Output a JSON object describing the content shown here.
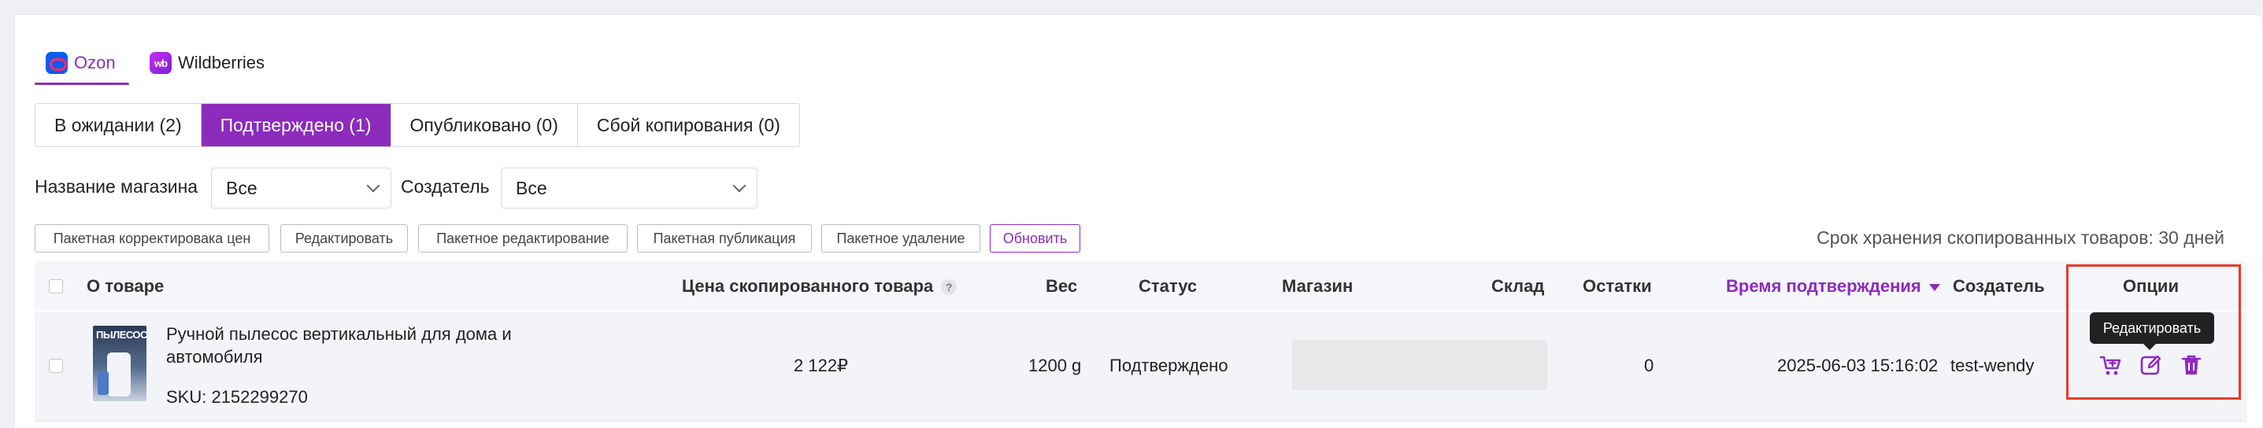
{
  "marketplace_tabs": [
    {
      "label": "Ozon",
      "active": true
    },
    {
      "label": "Wildberries",
      "active": false
    }
  ],
  "status_tabs": [
    {
      "label": "В ожидании (2)",
      "active": false
    },
    {
      "label": "Подтверждено (1)",
      "active": true
    },
    {
      "label": "Опубликовано (0)",
      "active": false
    },
    {
      "label": "Сбой копирования (0)",
      "active": false
    }
  ],
  "filters": {
    "store_label": "Название магазина",
    "store_value": "Все",
    "creator_label": "Создатель",
    "creator_value": "Все"
  },
  "actions": [
    "Пакетная корректировака цен",
    "Редактировать",
    "Пакетное редактирование",
    "Пакетная публикация",
    "Пакетное удаление",
    "Обновить"
  ],
  "retention_note": "Срок хранения скопированных товаров: 30 дней",
  "table": {
    "headers": {
      "product": "О товаре",
      "copied_price": "Цена скопированного товара",
      "weight": "Вес",
      "status": "Статус",
      "store": "Магазин",
      "warehouse": "Склад",
      "stock": "Остатки",
      "confirm_time": "Время подтверждения",
      "creator": "Создатель",
      "options": "Опции"
    },
    "rows": [
      {
        "thumb_text": "ПЫЛЕСОС",
        "title": "Ручной пылесос вертикальный для дома и автомобиля",
        "sku": "SKU: 2152299270",
        "price": "2 122₽",
        "weight": "1200 g",
        "status": "Подтверждено",
        "stock": "0",
        "confirm_time": "2025-06-03 15:16:02",
        "creator": "test-wendy"
      }
    ]
  },
  "tooltip": "Редактировать",
  "colors": {
    "accent": "#8d2bbd",
    "highlight_frame": "#e53a2a"
  },
  "option_icons": [
    "cart-plus-icon",
    "edit-icon",
    "trash-icon"
  ]
}
